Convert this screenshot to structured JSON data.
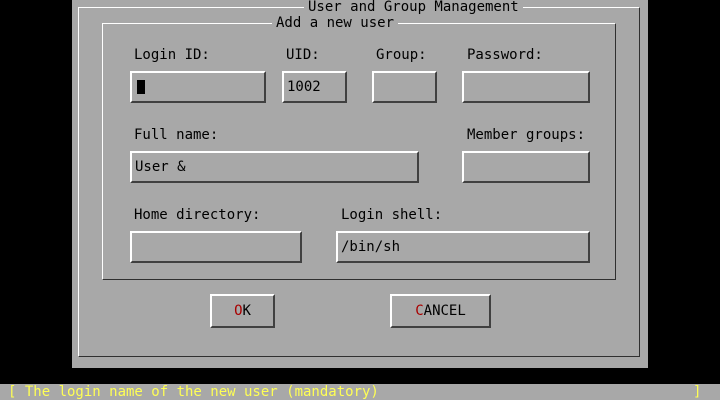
{
  "dialog": {
    "title": "User and Group Management",
    "section_title": "Add a new user"
  },
  "fields": {
    "login_id": {
      "label": "Login ID:",
      "value": ""
    },
    "uid": {
      "label": "UID:",
      "value": "1002"
    },
    "group": {
      "label": "Group:",
      "value": ""
    },
    "password": {
      "label": "Password:",
      "value": ""
    },
    "full_name": {
      "label": "Full name:",
      "value": "User &"
    },
    "member_groups": {
      "label": "Member groups:",
      "value": ""
    },
    "home_directory": {
      "label": "Home directory:",
      "value": ""
    },
    "login_shell": {
      "label": "Login shell:",
      "value": "/bin/sh"
    }
  },
  "buttons": {
    "ok": {
      "hotkey": "O",
      "rest": "K"
    },
    "cancel": {
      "hotkey": "C",
      "rest": "ANCEL"
    }
  },
  "status": {
    "text": "[ The login name of the new user (mandatory)",
    "end": "]"
  },
  "colors": {
    "dialog_bg": "#a8a8a8",
    "hotkey": "#a80000",
    "status_text": "#ffff54",
    "screen_bg": "#000000"
  }
}
